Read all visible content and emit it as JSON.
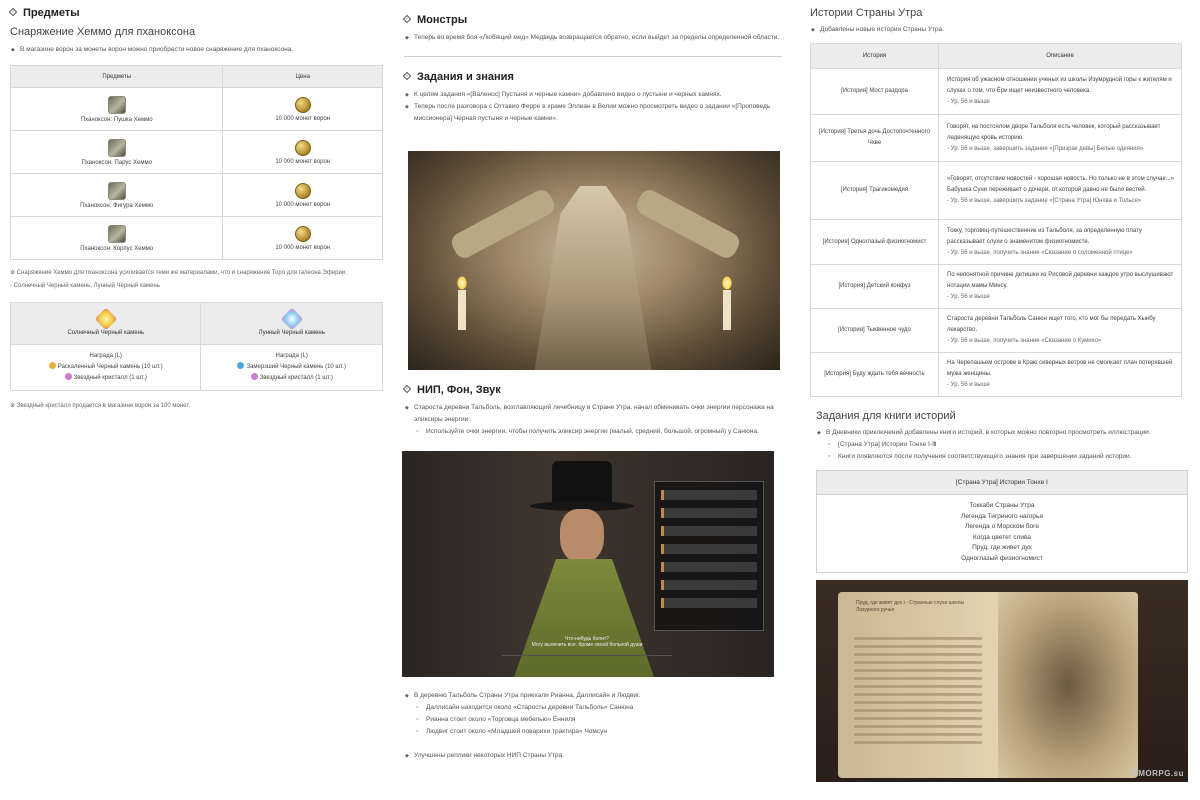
{
  "col1": {
    "heading": "Предметы",
    "subheading": "Снаряжение Хеммо для пханоксона",
    "intro": "В магазине ворон за монеты ворон можно приобрести новое снаряжение для пханоксона.",
    "table_headers": [
      "Предметы",
      "Цена"
    ],
    "items": [
      {
        "name": "Пханоксон: Пушка Хеммо",
        "price": "10 000 монет ворон"
      },
      {
        "name": "Пханоксон: Парус Хеммо",
        "price": "10 000 монет ворон"
      },
      {
        "name": "Пханоксон: Фигура Хеммо",
        "price": "10 000 монет ворон"
      },
      {
        "name": "Пханоксон: Корпус Хеммо",
        "price": "10 000 монет ворон"
      }
    ],
    "note1": "※ Снаряжение Хеммо для пханоксона усиливается теми же материалами, что и снаряжение Торо для галеона Эферии.",
    "note2": "- Солнечный Черный камень, Лунный Черный камень",
    "stones": {
      "headers": [
        "Солнечный Черный камень",
        "Лунный Черный камень"
      ],
      "reward_label": "Награда (L)",
      "left": [
        "Раскаленный Черный камень (10 шт.)",
        "Звездный кристалл (1 шт.)"
      ],
      "right": [
        "Замерзший Черный камень (10 шт.)",
        "Звездный кристалл (1 шт.)"
      ]
    },
    "note3": "※ Звездный кристалл продается в магазине ворон за 100 монет."
  },
  "col2": {
    "monsters_heading": "Монстры",
    "monsters_text": "Теперь во время боя «Любящий мед» Медведь возвращается обратно, если выйдет за пределы определенной области.",
    "quests_heading": "Задания и знания",
    "quests": [
      "К целям задания «[Валенос] Пустыня и черные камни» добавлено видео о пустыне и черных камнях.",
      "Теперь после разговора с Оттавио Ферре в храме Эллиан в Велии можно просмотреть видео о задании «[Проповедь миссионера] Черная пустыня и черные камни»."
    ],
    "npc_heading": "НИП, Фон, Звук",
    "npc_text": "Староста деревни Тальболь, возглавляющий лечебницу в Стране Утра, начал обменивать очки энергии персонажа на эликсиры энергии.",
    "npc_sub": "Используйте очки энергии, чтобы получить эликсир энергии (малый, средний, большой, огромный) у Санюна.",
    "npc_dialogue": [
      "Что-нибудь болит?",
      "Могу вылечить все. Кроме своей больной души"
    ],
    "arrivals": "В деревню Тальболь Страны Утра приехали Рианна, Даллисайн и Людвиг.",
    "arrivals_sub": [
      "Даллисайн находится около «Старосты деревни Тальболь» Санюна",
      "Рианна стоит около «Торговца мебелью» Ённиля",
      "Людвиг стоит около «Младшей поварихи трактира» Чомсун"
    ],
    "improved": "Улучшены реплики некоторых НИП Страны Утра."
  },
  "col3": {
    "stories_heading": "Истории Страны Утра",
    "stories_intro": "Добавлены новые истории Страны Утра.",
    "table_headers": [
      "История",
      "Описание"
    ],
    "stories": [
      {
        "name": "[История] Мост раздора",
        "desc": "История об ужасном отношении ученых из школы Изумрудной горы к жителям и слухах о том, что Ёри ищет неизвестного человека.",
        "meta": "- Ур. 56 и выше"
      },
      {
        "name": "[История] Третья дочь Достопочтенного Чхве",
        "desc": "Говорят, на постоялом дворе Тальболя есть человек, который рассказывает леденящую кровь историю.",
        "meta": "- Ур. 56 и выше, завершить задание «[Призрак девы] Белые одеяния»"
      },
      {
        "name": "[История] Трагикомедия",
        "desc": "«Говорят, отсутствие новостей - хорошая новость. Но только не в этом случае...» Бабушка Суни переживает о дочери, от которой давно не было вестей.",
        "meta": "- Ур. 56 и выше, завершить задание «[Страна Утра] Юнхва и Тольсе»"
      },
      {
        "name": "[История] Одноглазый физиогномист",
        "desc": "Токку, торговец-путешественник из Тальболя, за определенную плату рассказывает слухи о знаменитом физиогномисте.",
        "meta": "- Ур. 56 и выше, получить знание «Сказание о соломенной птице»"
      },
      {
        "name": "[История] Детский конфуз",
        "desc": "По непонятной причине детишки из Рисовой деревни каждое утро выслушивают нотации мамы Минсу.",
        "meta": "- Ур. 56 и выше"
      },
      {
        "name": "[История] Тыквенное чудо",
        "desc": "Староста деревни Тальболь Санюн ищет того, кто мог бы передать Хынбу лекарство.",
        "meta": "- Ур. 56 и выше, получить знание «Сказание о Кумихо»"
      },
      {
        "name": "[История] Буду ждать тебя вечность",
        "desc": "На Черепашьем острове в Краю северных ветров не смолкает плач потерявшей мужа женщины.",
        "meta": "- Ур. 56 и выше"
      }
    ],
    "book_heading": "Задания для книги историй",
    "book_items": [
      "В Дневники приключений добавлены книги историй, в которых можно повторно просмотреть иллюстрации.",
      "[Страна Утра] Истории Тонхе Ⅰ-Ⅲ",
      "Книги появляются после получения соответствующего знания при завершении заданий истории."
    ],
    "book_table_title": "[Страна Утра] Истории Тонхе Ⅰ",
    "book_list": [
      "Токкаби Страны Утра",
      "Легенда Тигриного нагорья",
      "Легенда о Морском боге",
      "Когда цветет слива",
      "Пруд, где живет дух",
      "Одноглазый физиогномист"
    ],
    "book_image_title": "Пруд, где живет дух Ⅰ - Странные слухи школы Лазурного ручья",
    "watermark": "MMORPG.su"
  }
}
